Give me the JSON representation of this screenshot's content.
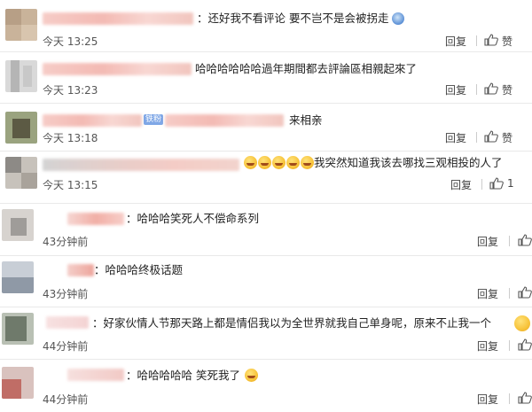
{
  "comments": [
    {
      "text": "：还好我不看评论  要不岂不是会被拐走",
      "time": "13:25",
      "time_prefix": "今天",
      "reply": "回复",
      "like": "赞"
    },
    {
      "text": "哈哈哈哈哈哈過年期間都去評論區相親起來了",
      "time": "13:23",
      "time_prefix": "今天",
      "reply": "回复",
      "like": "赞"
    },
    {
      "text": "来相亲",
      "badge": "铁粉",
      "time": "13:18",
      "time_prefix": "今天",
      "reply": "回复",
      "like": "赞"
    },
    {
      "text": "我突然知道我该去哪找三观相投的人了",
      "time": "13:15",
      "time_prefix": "今天",
      "reply": "回复",
      "like": "1"
    },
    {
      "text": "：哈哈哈笑死人不偿命系列",
      "time": "43分钟前",
      "reply": "回复",
      "like": ""
    },
    {
      "text": "：哈哈哈终极话题",
      "time": "43分钟前",
      "reply": "回复",
      "like": ""
    },
    {
      "text": "：好家伙情人节那天路上都是情侣我以为全世界就我自己单身呢，原来不止我一个",
      "time": "44分钟前",
      "reply": "回复",
      "like": ""
    },
    {
      "text": "：哈哈哈哈哈  笑死我了",
      "time": "44分钟前",
      "reply": "回复",
      "like": ""
    }
  ],
  "icons": {
    "like": "thumbs-up-icon",
    "emoji": "laughing-emoji-icon"
  }
}
